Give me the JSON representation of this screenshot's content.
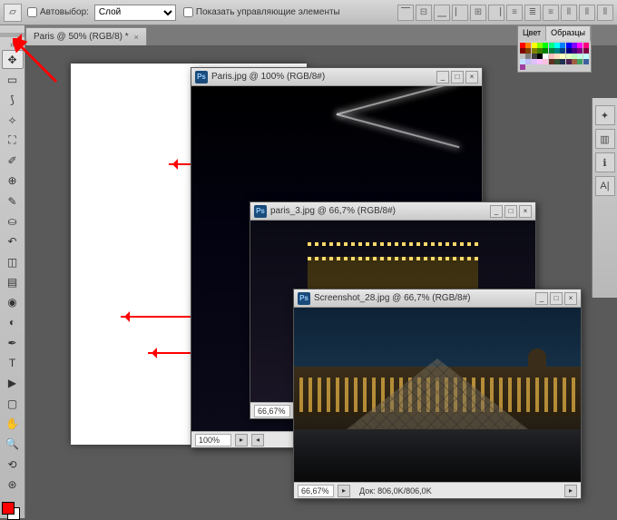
{
  "options_bar": {
    "auto_select_label": "Автовыбор:",
    "auto_select_checked": false,
    "layer_dropdown": "Слой",
    "show_controls_label": "Показать управляющие элементы",
    "show_controls_checked": false
  },
  "document_tab": {
    "title": "Paris @ 50% (RGB/8) *"
  },
  "toolbox": {
    "tools": [
      "move",
      "marquee",
      "lasso",
      "wand",
      "crop",
      "eyedropper",
      "heal",
      "brush",
      "stamp",
      "history-brush",
      "eraser",
      "gradient",
      "blur",
      "dodge",
      "pen",
      "type",
      "path-select",
      "rectangle",
      "hand",
      "zoom",
      "3d-rotate",
      "3d-orbit"
    ],
    "fg_color": "#ff0000",
    "bg_color": "#ffffff"
  },
  "image_windows": [
    {
      "id": "win_eiffel",
      "title": "Paris.jpg @ 100% (RGB/8#)",
      "zoom": "100%"
    },
    {
      "id": "win_arc",
      "title": "paris_3.jpg @ 66,7% (RGB/8#)",
      "zoom": "66,67%"
    },
    {
      "id": "win_louvre",
      "title": "Screenshot_28.jpg @ 66,7% (RGB/8#)",
      "zoom": "66,67%",
      "status_doc": "Док: 806,0K/806,0K"
    }
  ],
  "right_panel": {
    "tab_color": "Цвет",
    "tab_swatches": "Образцы",
    "swatch_colors": [
      "#ff0000",
      "#ff8000",
      "#ffff00",
      "#80ff00",
      "#00ff00",
      "#00ff80",
      "#00ffff",
      "#0080ff",
      "#0000ff",
      "#8000ff",
      "#ff00ff",
      "#ff0080",
      "#800000",
      "#804000",
      "#808000",
      "#408000",
      "#008000",
      "#008040",
      "#008080",
      "#004080",
      "#000080",
      "#400080",
      "#800080",
      "#800040",
      "#c0c0c0",
      "#808080",
      "#404040",
      "#000000",
      "#ffffff",
      "#ffc0c0",
      "#ffe0c0",
      "#ffffc0",
      "#e0ffc0",
      "#c0ffc0",
      "#c0ffe0",
      "#c0ffff",
      "#c0e0ff",
      "#c0c0ff",
      "#e0c0ff",
      "#ffc0ff",
      "#ffc0e0",
      "#603020",
      "#305030",
      "#203050",
      "#502050",
      "#a06040",
      "#40a060",
      "#4060a0",
      "#a040a0"
    ]
  }
}
